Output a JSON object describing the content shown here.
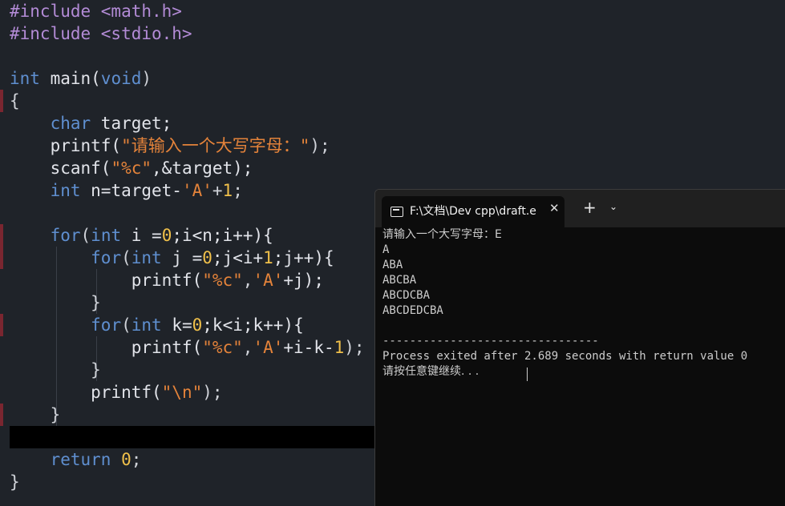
{
  "editor": {
    "lines": [
      [
        {
          "t": "#include <math.h>",
          "c": "pp"
        }
      ],
      [
        {
          "t": "#include <stdio.h>",
          "c": "pp"
        }
      ],
      [],
      [
        {
          "t": "int",
          "c": "kw"
        },
        {
          "t": " main(",
          "c": "id"
        },
        {
          "t": "void",
          "c": "kw"
        },
        {
          "t": ")",
          "c": "pun"
        }
      ],
      [
        {
          "t": "{",
          "c": "pun"
        }
      ],
      [
        {
          "t": "    ",
          "c": "id"
        },
        {
          "t": "char",
          "c": "kw"
        },
        {
          "t": " target;",
          "c": "id"
        }
      ],
      [
        {
          "t": "    printf(",
          "c": "id"
        },
        {
          "t": "\"请输入一个大写字母：\"",
          "c": "str"
        },
        {
          "t": ");",
          "c": "pun"
        }
      ],
      [
        {
          "t": "    scanf(",
          "c": "id"
        },
        {
          "t": "\"%c\"",
          "c": "str"
        },
        {
          "t": ",&target);",
          "c": "id"
        }
      ],
      [
        {
          "t": "    ",
          "c": "id"
        },
        {
          "t": "int",
          "c": "kw"
        },
        {
          "t": " n=target-",
          "c": "id"
        },
        {
          "t": "'A'",
          "c": "str"
        },
        {
          "t": "+",
          "c": "pun"
        },
        {
          "t": "1",
          "c": "num"
        },
        {
          "t": ";",
          "c": "pun"
        }
      ],
      [],
      [
        {
          "t": "    ",
          "c": "id"
        },
        {
          "t": "for",
          "c": "kw"
        },
        {
          "t": "(",
          "c": "pun"
        },
        {
          "t": "int",
          "c": "kw"
        },
        {
          "t": " i =",
          "c": "id"
        },
        {
          "t": "0",
          "c": "num"
        },
        {
          "t": ";i<n;i++){",
          "c": "id"
        }
      ],
      [
        {
          "t": "        ",
          "c": "id"
        },
        {
          "t": "for",
          "c": "kw"
        },
        {
          "t": "(",
          "c": "pun"
        },
        {
          "t": "int",
          "c": "kw"
        },
        {
          "t": " j =",
          "c": "id"
        },
        {
          "t": "0",
          "c": "num"
        },
        {
          "t": ";j<i+",
          "c": "id"
        },
        {
          "t": "1",
          "c": "num"
        },
        {
          "t": ";j++){",
          "c": "id"
        }
      ],
      [
        {
          "t": "            printf(",
          "c": "id"
        },
        {
          "t": "\"%c\"",
          "c": "str"
        },
        {
          "t": ",",
          "c": "pun"
        },
        {
          "t": "'A'",
          "c": "str"
        },
        {
          "t": "+j);",
          "c": "id"
        }
      ],
      [
        {
          "t": "        }",
          "c": "pun"
        }
      ],
      [
        {
          "t": "        ",
          "c": "id"
        },
        {
          "t": "for",
          "c": "kw"
        },
        {
          "t": "(",
          "c": "pun"
        },
        {
          "t": "int",
          "c": "kw"
        },
        {
          "t": " k=",
          "c": "id"
        },
        {
          "t": "0",
          "c": "num"
        },
        {
          "t": ";k<i;k++){",
          "c": "id"
        }
      ],
      [
        {
          "t": "            printf(",
          "c": "id"
        },
        {
          "t": "\"%c\"",
          "c": "str"
        },
        {
          "t": ",",
          "c": "pun"
        },
        {
          "t": "'A'",
          "c": "str"
        },
        {
          "t": "+i-k-",
          "c": "id"
        },
        {
          "t": "1",
          "c": "num"
        },
        {
          "t": ");",
          "c": "pun"
        }
      ],
      [
        {
          "t": "        }",
          "c": "pun"
        }
      ],
      [
        {
          "t": "        printf(",
          "c": "id"
        },
        {
          "t": "\"\\n\"",
          "c": "str"
        },
        {
          "t": ");",
          "c": "pun"
        }
      ],
      [
        {
          "t": "    }",
          "c": "pun"
        }
      ],
      [],
      [
        {
          "t": "    ",
          "c": "id"
        },
        {
          "t": "return",
          "c": "kw"
        },
        {
          "t": " ",
          "c": "id"
        },
        {
          "t": "0",
          "c": "num"
        },
        {
          "t": ";",
          "c": "pun"
        }
      ],
      [
        {
          "t": "}",
          "c": "pun"
        }
      ]
    ]
  },
  "terminal": {
    "tab_title": "F:\\文档\\Dev cpp\\draft.e",
    "tab_close": "✕",
    "new_tab": "+",
    "dropdown": "⌄",
    "output": [
      "请输入一个大写字母：E",
      "A",
      "ABA",
      "ABCBA",
      "ABCDCBA",
      "ABCDEDCBA",
      "",
      "--------------------------------",
      "Process exited after 2.689 seconds with return value 0",
      "请按任意键继续. . ."
    ]
  }
}
